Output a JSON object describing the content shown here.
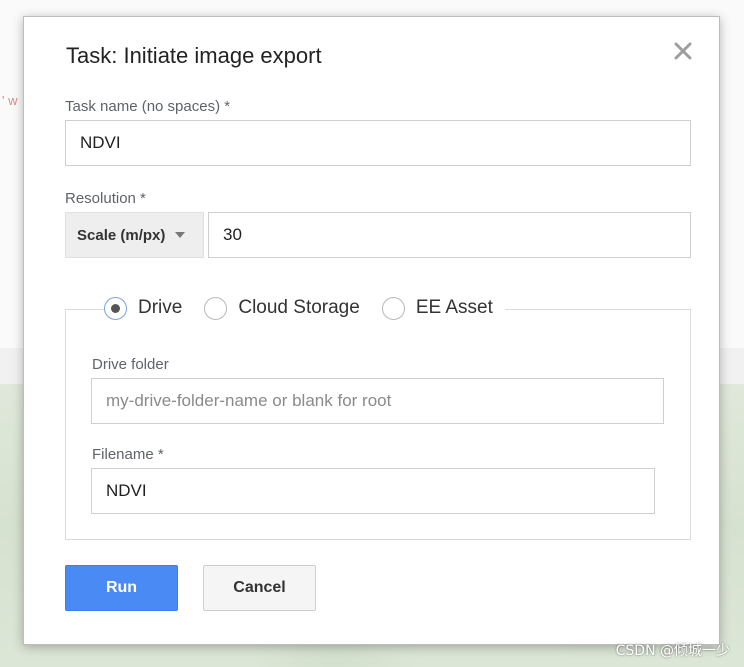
{
  "background": {
    "fragment_text": "' w"
  },
  "dialog": {
    "title": "Task: Initiate image export",
    "task_name": {
      "label": "Task name (no spaces) *",
      "value": "NDVI"
    },
    "resolution": {
      "label": "Resolution *",
      "scale_option": "Scale (m/px)",
      "value": "30"
    },
    "destination": {
      "options": [
        "Drive",
        "Cloud Storage",
        "EE Asset"
      ],
      "selected": "Drive"
    },
    "drive_folder": {
      "label": "Drive folder",
      "placeholder": "my-drive-folder-name or blank for root",
      "value": ""
    },
    "filename": {
      "label": "Filename *",
      "value": "NDVI"
    },
    "buttons": {
      "run": "Run",
      "cancel": "Cancel"
    }
  },
  "watermark": "CSDN @倾城一少",
  "colors": {
    "accent": "#4a8af4",
    "radio_ring": "#7aa3e6"
  },
  "icons": {
    "close": "close-icon",
    "caret": "chevron-down-icon"
  }
}
